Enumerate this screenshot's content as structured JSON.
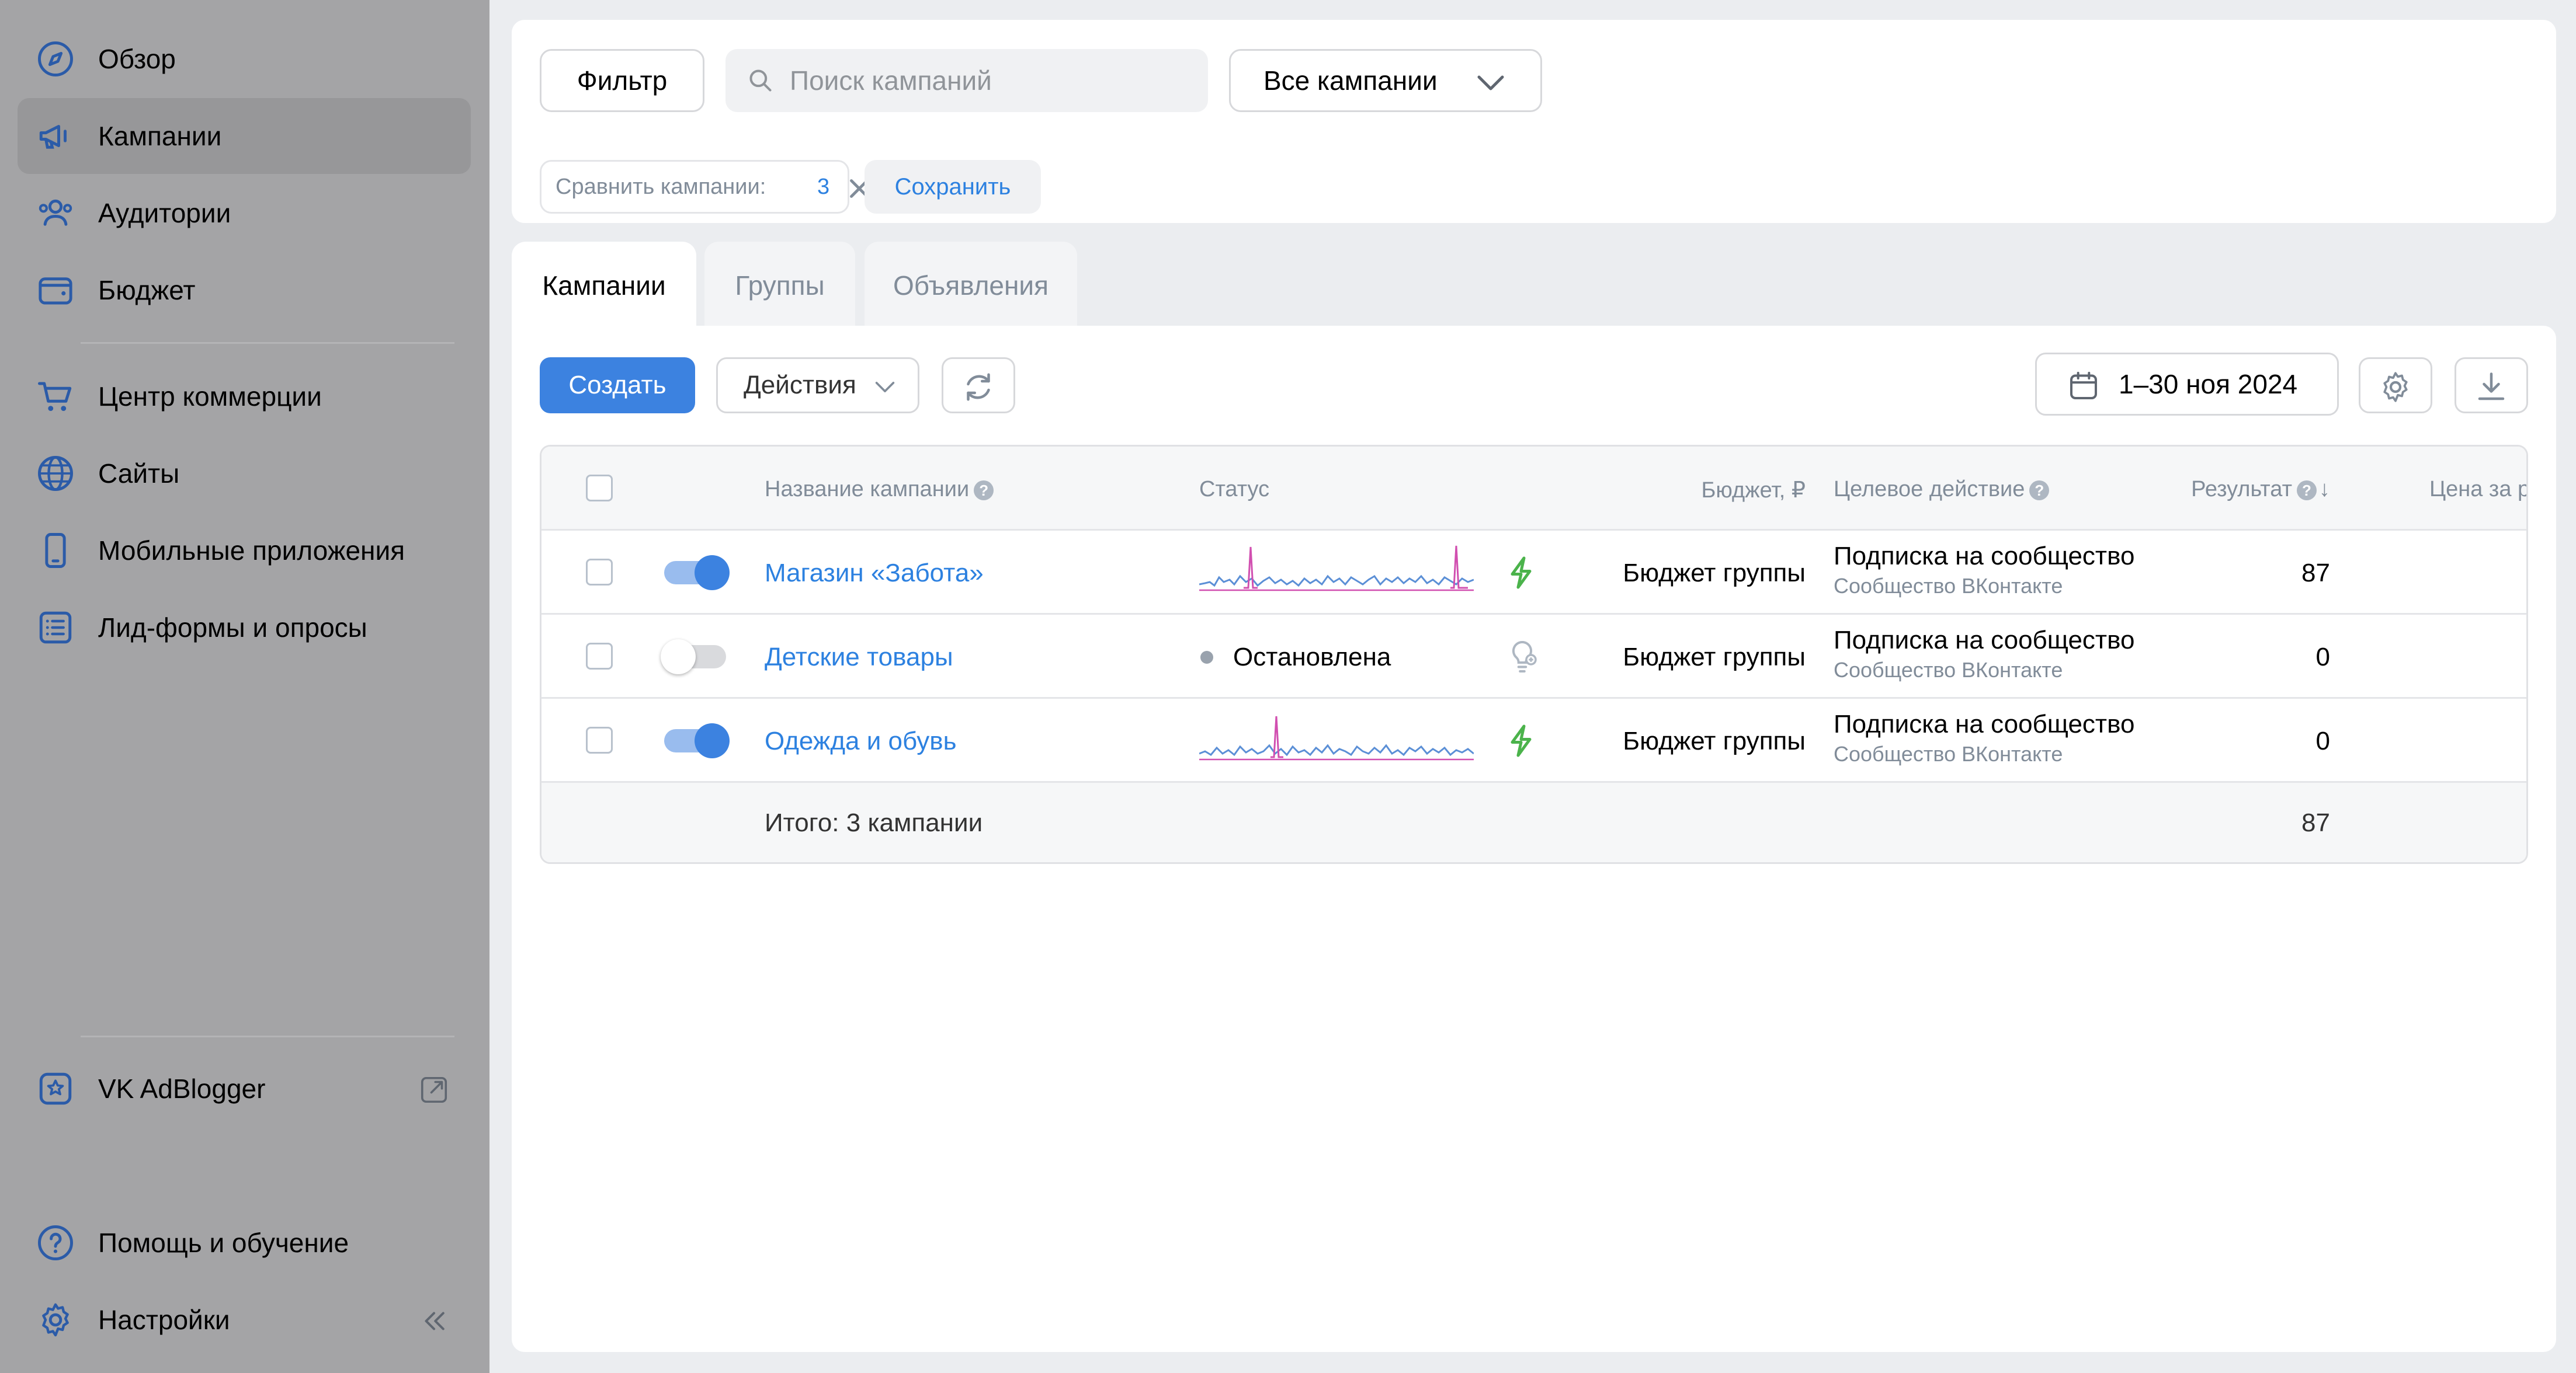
{
  "sidebar": {
    "items": [
      {
        "label": "Обзор",
        "icon": "compass-icon"
      },
      {
        "label": "Кампании",
        "icon": "megaphone-icon"
      },
      {
        "label": "Аудитории",
        "icon": "users-icon"
      },
      {
        "label": "Бюджет",
        "icon": "wallet-icon"
      },
      {
        "label": "Центр коммерции",
        "icon": "cart-icon"
      },
      {
        "label": "Сайты",
        "icon": "globe-icon"
      },
      {
        "label": "Мобильные приложения",
        "icon": "phone-icon"
      },
      {
        "label": "Лид-формы и опросы",
        "icon": "list-icon"
      }
    ],
    "adblogger": {
      "label": "VK AdBlogger",
      "icon": "adblogger-icon"
    },
    "help": {
      "label": "Помощь и обучение",
      "icon": "help-icon"
    },
    "settings": {
      "label": "Настройки",
      "icon": "gear-icon"
    }
  },
  "filters": {
    "filter_label": "Фильтр",
    "search_placeholder": "Поиск кампаний",
    "campaign_select": "Все кампании",
    "compare_label": "Сравнить кампании:",
    "compare_count": "3",
    "save_label": "Сохранить"
  },
  "tabs": [
    {
      "label": "Кампании",
      "active": true
    },
    {
      "label": "Группы",
      "active": false
    },
    {
      "label": "Объявления",
      "active": false
    }
  ],
  "toolbar": {
    "create_label": "Создать",
    "actions_label": "Действия",
    "date_range": "1–30 ноя 2024"
  },
  "table": {
    "columns": {
      "name": "Название кампании",
      "status": "Статус",
      "budget": "Бюджет, ₽",
      "target": "Целевое действие",
      "result": "Результат",
      "price": "Цена за рез"
    },
    "rows": [
      {
        "name": "Магазин «Забота»",
        "enabled": true,
        "status": "",
        "budget": "Бюджет группы",
        "target": "Подписка на сообщество",
        "target_sub": "Сообщество ВКонтакте",
        "result": "87"
      },
      {
        "name": "Детские товары",
        "enabled": false,
        "status": "Остановлена",
        "budget": "Бюджет группы",
        "target": "Подписка на сообщество",
        "target_sub": "Сообщество ВКонтакте",
        "result": "0"
      },
      {
        "name": "Одежда и обувь",
        "enabled": true,
        "status": "",
        "budget": "Бюджет группы",
        "target": "Подписка на сообщество",
        "target_sub": "Сообщество ВКонтакте",
        "result": "0"
      }
    ],
    "total_label": "Итого: 3 кампании",
    "total_result": "87"
  },
  "colors": {
    "accent": "#3c82e0",
    "link": "#2d81e0",
    "sidebar_bg": "#a4a4a6",
    "spark_blue": "#5b8fd6",
    "spark_pink": "#d14fb0",
    "bolt_green": "#4bb34b"
  }
}
